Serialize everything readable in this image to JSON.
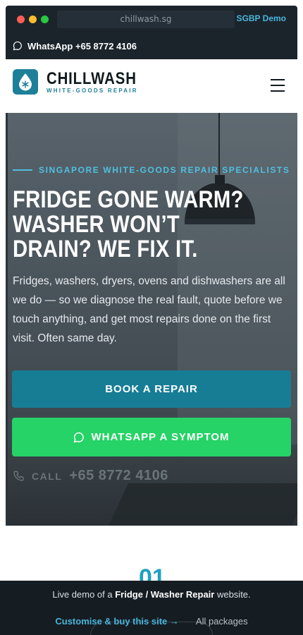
{
  "browser": {
    "url": "chillwash.sg",
    "demo_label": "SGBP Demo"
  },
  "topbar": {
    "whatsapp_text": "WhatsApp +65 8772 4106"
  },
  "header": {
    "brand_name": "CHILLWASH",
    "brand_tagline": "WHITE-GOODS REPAIR"
  },
  "hero": {
    "eyebrow": "SINGAPORE WHITE-GOODS REPAIR SPECIALISTS",
    "headline_line1": "FRIDGE GONE WARM?",
    "headline_line2": "WASHER WON’T",
    "headline_line3": "DRAIN? WE FIX IT.",
    "lede": "Fridges, washers, dryers, ovens and dishwashers are all we do — so we diagnose the real fault, quote before we touch anything, and get most repairs done on the first visit. Often same day.",
    "book_label": "BOOK A REPAIR",
    "whatsapp_label": "WHATSAPP A SYMPTOM",
    "call_label": "CALL",
    "call_number": "+65 8772 4106"
  },
  "section": {
    "number": "01"
  },
  "demo_bar": {
    "text_prefix": "Live demo of a ",
    "text_bold": "Fridge / Washer Repair",
    "text_suffix": " website.",
    "customise_label": "Customise & buy this site →",
    "packages_label": "All packages"
  },
  "colors": {
    "brand_teal": "#1e7f99",
    "accent_cyan": "#4fc0e2",
    "whatsapp_green": "#25d366",
    "dark_bar": "#1b242b"
  }
}
